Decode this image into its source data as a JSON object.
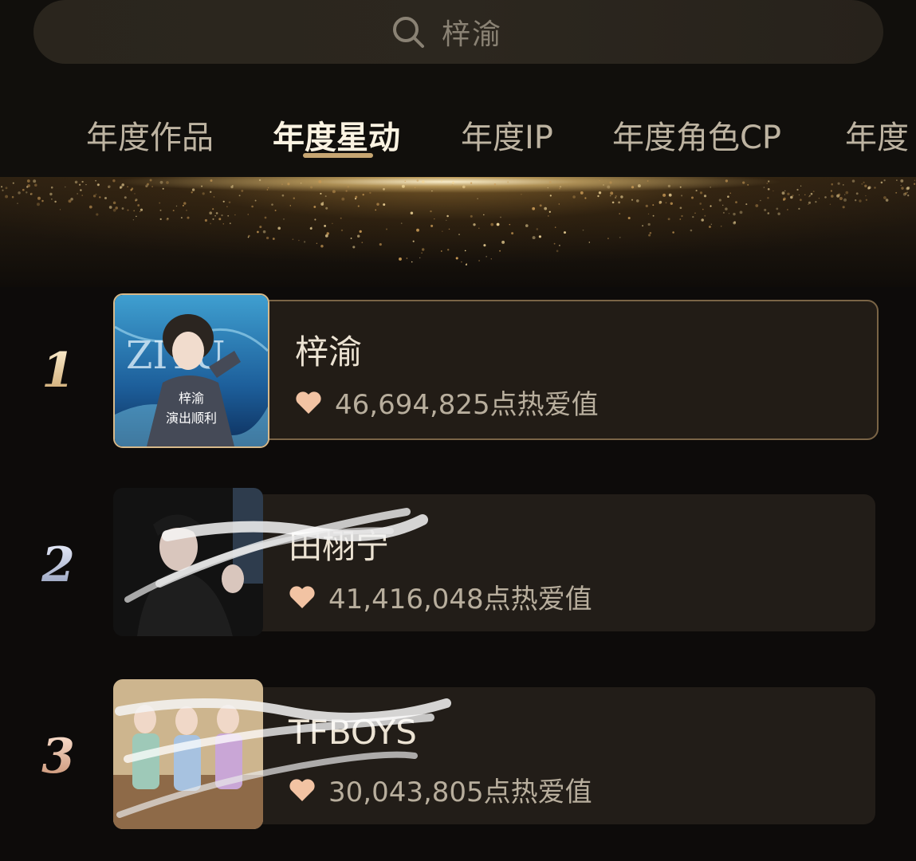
{
  "search": {
    "placeholder_text": "梓渝"
  },
  "tabs": [
    {
      "label": "年度作品",
      "active": false
    },
    {
      "label": "年度星动",
      "active": true
    },
    {
      "label": "年度IP",
      "active": false
    },
    {
      "label": "年度角色CP",
      "active": false
    },
    {
      "label": "年度",
      "active": false
    }
  ],
  "ranking": [
    {
      "rank": "1",
      "name": "梓渝",
      "value": "46,694,825点热爱值",
      "poster_text": "ZIYU",
      "poster_caption_1": "梓渝",
      "poster_caption_2": "演出顺利"
    },
    {
      "rank": "2",
      "name": "田栩宁",
      "value": "41,416,048点热爱值"
    },
    {
      "rank": "3",
      "name": "TFBOYS",
      "value": "30,043,805点热爱值"
    }
  ],
  "colors": {
    "background": "#0d0b0a",
    "accent_gold": "#c7a672",
    "heart": "#f2c3a3"
  },
  "icons": [
    "search-icon",
    "heart-icon"
  ]
}
